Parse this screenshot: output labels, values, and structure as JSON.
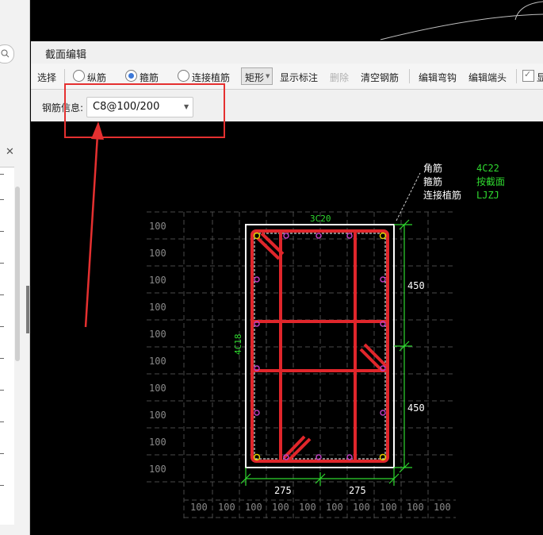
{
  "dialog": {
    "title": "截面编辑"
  },
  "toolbar": {
    "select": "选择",
    "longitudinal": "纵筋",
    "stirrup": "箍筋",
    "anchor_bar": "连接植筋",
    "shape": "矩形",
    "show_annotation": "显示标注",
    "delete": "删除",
    "clear_bars": "清空钢筋",
    "edit_hook": "编辑弯钩",
    "edit_end": "编辑端头",
    "show_partial": "显"
  },
  "info": {
    "label": "钢筋信息:",
    "value": "C8@100/200"
  },
  "annotations": {
    "corner_label": "角筋",
    "corner_value": "4C22",
    "stirrup_label": "箍筋",
    "stirrup_value": "按截面",
    "anchor_label": "连接植筋",
    "anchor_value": "LJZJ",
    "top_bars": "3C20",
    "side_bars": "4C18",
    "dim_h1": "450",
    "dim_h2": "450",
    "dim_w1": "275",
    "dim_w2": "275",
    "grid_tick": "100"
  },
  "colors": {
    "rebar": "#e0262b",
    "annotation_green": "#2fd82f",
    "highlight": "#e53030"
  }
}
